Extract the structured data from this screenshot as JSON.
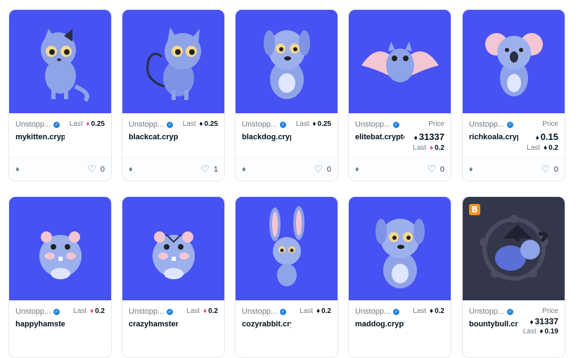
{
  "cards": [
    {
      "collection": "Unstopp...",
      "name": "mykitten.crypto",
      "label": "Last",
      "value": "0.25",
      "eth_color": "pink",
      "likes": "0",
      "animal": "kitten"
    },
    {
      "collection": "Unstopp...",
      "name": "blackcat.crypto",
      "label": "Last",
      "value": "0.25",
      "eth_color": "dark",
      "likes": "1",
      "animal": "cat"
    },
    {
      "collection": "Unstopp...",
      "name": "blackdog.crypto",
      "label": "Last",
      "value": "0.25",
      "eth_color": "dark",
      "likes": "0",
      "animal": "dog"
    },
    {
      "collection": "Unstopp...",
      "name": "elitebat.crypto",
      "label": "Price",
      "value": "31337",
      "sub_label": "Last",
      "sub_value": "0.2",
      "likes": "0",
      "animal": "bat"
    },
    {
      "collection": "Unstopp...",
      "name": "richkoala.crypto",
      "label": "Price",
      "value": "0.15",
      "sub_label": "Last",
      "sub_value": "0.2",
      "likes": "0",
      "animal": "koala"
    },
    {
      "collection": "Unstopp...",
      "name": "happyhamster.crypto",
      "label": "Last",
      "value": "0.2",
      "eth_color": "pink",
      "animal": "hamster"
    },
    {
      "collection": "Unstopp...",
      "name": "crazyhamster.crypto",
      "label": "Last",
      "value": "0.2",
      "eth_color": "pink",
      "animal": "hamster2"
    },
    {
      "collection": "Unstopp...",
      "name": "cozyrabbit.crypto",
      "label": "Last",
      "value": "0.2",
      "eth_color": "dark",
      "animal": "rabbit"
    },
    {
      "collection": "Unstopp...",
      "name": "maddog.crypto",
      "label": "Last",
      "value": "0.2",
      "eth_color": "dark",
      "animal": "dog2"
    },
    {
      "collection": "Unstopp...",
      "name": "bountybull.crypto",
      "label": "Price",
      "value": "31337",
      "sub_label": "Last",
      "sub_value": "0.19",
      "animal": "bull",
      "badge": "B"
    }
  ],
  "icons": {
    "eth": "ethereum-icon",
    "heart": "heart-icon",
    "verified": "verified-badge-icon"
  },
  "colors": {
    "card_bg": "#4752f3",
    "dark_bg": "#34374a",
    "eth_pink": "#e2507a"
  }
}
